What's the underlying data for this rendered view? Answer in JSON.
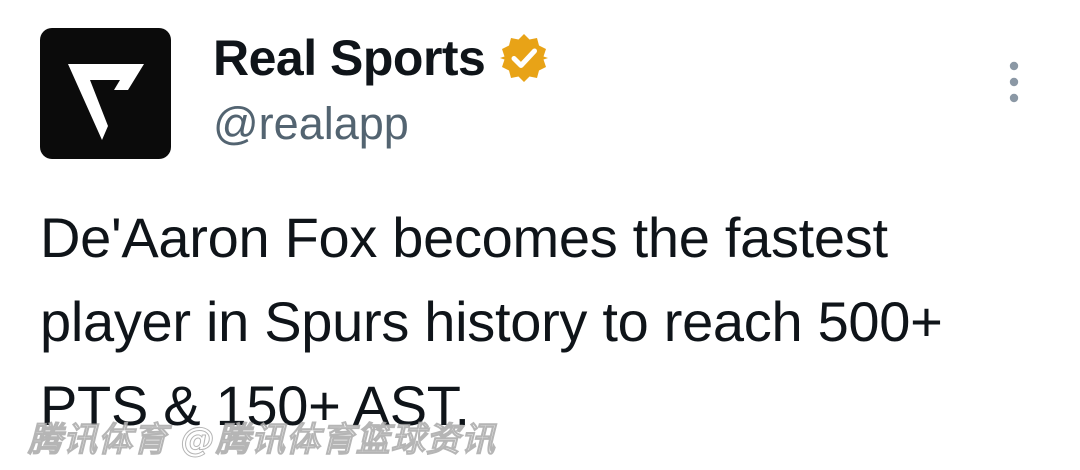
{
  "account": {
    "display_name": "Real Sports",
    "handle": "@realapp",
    "verified": true,
    "verified_badge_color": "#e8a317",
    "avatar_icon": "real-sports-logo-icon"
  },
  "tweet": {
    "text": "De'Aaron Fox becomes the fastest player in Spurs history to reach 500+ PTS & 150+ AST."
  },
  "menu": {
    "more_icon": "more-vertical-icon"
  },
  "watermark": {
    "text": "腾讯体育 @腾讯体育篮球资讯"
  },
  "colors": {
    "text_primary": "#0f1419",
    "text_secondary": "#536471",
    "avatar_bg": "#0b0b0b",
    "more_icon": "#8b98a5"
  }
}
